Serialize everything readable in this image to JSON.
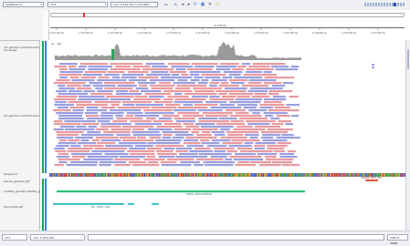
{
  "toolbar": {
    "genome": "hg38/hub.fa",
    "chromosome": "chr1",
    "locus": "chr1:1,232,101-1,234,900",
    "go_label": "Go"
  },
  "ruler": {
    "scale_label": "2,279 kb",
    "ticks": [
      "1,231,500 bp",
      "1,232,000 bp",
      "1,232,500 bp",
      "1,233,000 bp",
      "1,233,500 bp",
      "1,234,000 bp",
      "1,234,500 bp",
      "1,235,000 bp",
      "1,235,500 bp",
      "1,236,000 bp",
      "1,236,500 bp",
      "1,237,000 bp"
    ]
  },
  "tracks": {
    "coverage_name": "am.gamlam.sortedm.bam Coverage",
    "coverage_range": "[0 - 46]",
    "alignment_name": "am.gamlam.sortedm.bam",
    "sequence_name": "Sequence",
    "gene_name": "Genes_gamlam.gtf",
    "feature_name": "sncRNA_gamlam.SIGMA_gene_cds.gff",
    "extra_name": "transcripts.gtf",
    "gene_feature_label": "TRAS_0001230010",
    "small_feature_label": "TIC_0001_001",
    "extra_feature_label": "TRANS_0001_010"
  },
  "status": {
    "left_text": "chr1",
    "locus_text": "chr1:1,233,249",
    "right_text": "54M of 488M"
  },
  "colors": {
    "read_forward": "#e99a9e",
    "read_reverse": "#9a9fe0",
    "coverage": "#9a9a9a",
    "coverage_peak": "#2fa05a",
    "feature_green": "#2fc07a",
    "feature_teal": "#27b9c8",
    "feature_red": "#e05a3a"
  }
}
